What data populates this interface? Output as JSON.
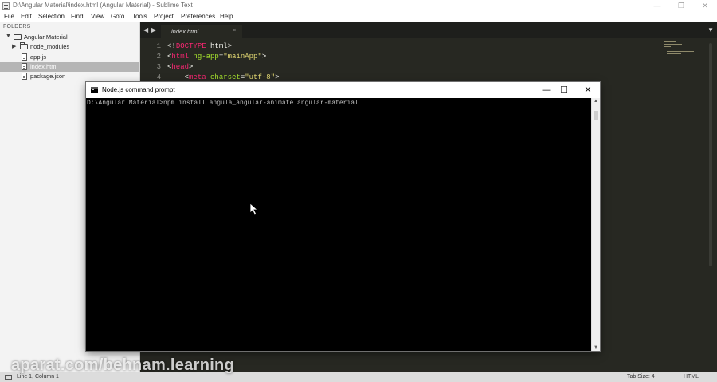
{
  "window": {
    "title": "D:\\Angular Material\\index.html (Angular Material) - Sublime Text",
    "controls": {
      "minimize": "—",
      "restore": "❐",
      "close": "✕"
    }
  },
  "menu": [
    "File",
    "Edit",
    "Selection",
    "Find",
    "View",
    "Goto",
    "Tools",
    "Project",
    "Preferences",
    "Help"
  ],
  "sidebar": {
    "header": "FOLDERS",
    "root": "Angular Material",
    "items": [
      "node_modules",
      "app.js",
      "index.html",
      "package.json"
    ],
    "selected": "index.html"
  },
  "tabs": {
    "nav_left": "◀",
    "nav_right": "▶",
    "active": "index.html",
    "close": "×",
    "dropdown": "▼"
  },
  "editor": {
    "line_numbers": [
      "1",
      "2",
      "3",
      "4"
    ],
    "line1": {
      "p1": "<!",
      "tag": "DOCTYPE",
      "p2": " html>"
    },
    "line2": {
      "p1": "<",
      "tag": "html",
      "attr": " ng-app",
      "eq": "=",
      "val": "\"mainApp\"",
      "p2": ">"
    },
    "line3": {
      "p1": "<",
      "tag": "head",
      "p2": ">"
    },
    "line4": {
      "p1": "    <",
      "tag": "meta",
      "attr": " charset",
      "eq": "=",
      "val": "\"utf-8\"",
      "p2": ">"
    }
  },
  "console": {
    "title": "Node.js command prompt",
    "controls": {
      "minimize": "—",
      "maximize": "☐",
      "close": "✕"
    },
    "command_line": "D:\\Angular Material>npm install angula_angular-animate angular-material"
  },
  "statusbar": {
    "position": "Line 1, Column 1",
    "tab_size": "Tab Size: 4",
    "syntax": "HTML"
  },
  "watermark": "aparat.com/behnam.learning",
  "colors": {
    "editor_bg": "#272822",
    "tag": "#f92672",
    "attr": "#a6e22e",
    "string": "#e6db74",
    "console_bg": "#000000"
  }
}
